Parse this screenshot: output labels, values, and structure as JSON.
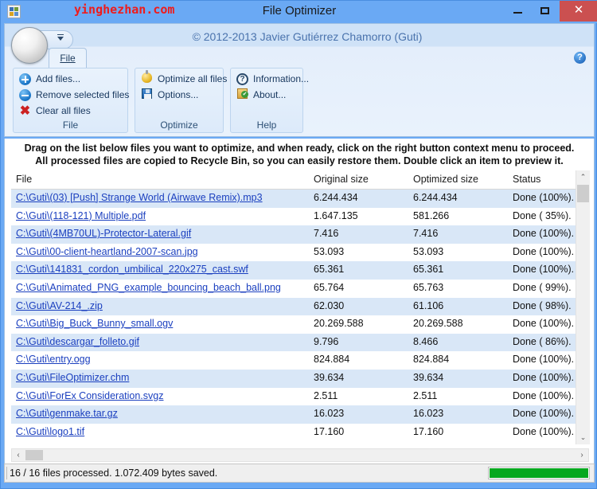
{
  "titlebar": {
    "app_icon": "app-grid-icon",
    "watermark": "yinghezhan.com",
    "title": "File Optimizer",
    "minimize_label": "",
    "maximize_label": "",
    "close_label": ""
  },
  "ribbon": {
    "copyright": "© 2012-2013 Javier Gutiérrez Chamorro (Guti)",
    "tab_label": "File",
    "help_glyph": "?",
    "groups": [
      {
        "label": "File",
        "items": [
          {
            "icon": "add-circle-icon",
            "label": "Add files..."
          },
          {
            "icon": "remove-circle-icon",
            "label": "Remove selected files"
          },
          {
            "icon": "red-x-icon",
            "label": "Clear all files"
          }
        ]
      },
      {
        "label": "Optimize",
        "items": [
          {
            "icon": "gold-bulb-icon",
            "label": "Optimize all files"
          },
          {
            "icon": "floppy-disk-icon",
            "label": "Options..."
          }
        ]
      },
      {
        "label": "Help",
        "items": [
          {
            "icon": "question-mark-icon",
            "label": "Information..."
          },
          {
            "icon": "about-badge-icon",
            "label": "About..."
          }
        ]
      }
    ]
  },
  "banner": {
    "line1": "Drag on the list below files you want to optimize, and when ready, click on the right button context menu to proceed. All",
    "line2": "processed files are copied to Recycle Bin, so you can easily restore them. Double click an item to preview it."
  },
  "list": {
    "columns": [
      "File",
      "Original size",
      "Optimized size",
      "Status"
    ],
    "rows": [
      {
        "file": "C:\\Guti\\(03) [Push] Strange World (Airwave Remix).mp3",
        "original": "6.244.434",
        "optimized": "6.244.434",
        "status": "Done (100%)."
      },
      {
        "file": "C:\\Guti\\(118-121) Multiple.pdf",
        "original": "1.647.135",
        "optimized": "581.266",
        "status": "Done ( 35%)."
      },
      {
        "file": "C:\\Guti\\(4MB70UL)-Protector-Lateral.gif",
        "original": "7.416",
        "optimized": "7.416",
        "status": "Done (100%)."
      },
      {
        "file": "C:\\Guti\\00-client-heartland-2007-scan.jpg",
        "original": "53.093",
        "optimized": "53.093",
        "status": "Done (100%)."
      },
      {
        "file": "C:\\Guti\\141831_cordon_umbilical_220x275_cast.swf",
        "original": "65.361",
        "optimized": "65.361",
        "status": "Done (100%)."
      },
      {
        "file": "C:\\Guti\\Animated_PNG_example_bouncing_beach_ball.png",
        "original": "65.764",
        "optimized": "65.763",
        "status": "Done ( 99%)."
      },
      {
        "file": "C:\\Guti\\AV-214_.zip",
        "original": "62.030",
        "optimized": "61.106",
        "status": "Done ( 98%)."
      },
      {
        "file": "C:\\Guti\\Big_Buck_Bunny_small.ogv",
        "original": "20.269.588",
        "optimized": "20.269.588",
        "status": "Done (100%)."
      },
      {
        "file": "C:\\Guti\\descargar_folleto.gif",
        "original": "9.796",
        "optimized": "8.466",
        "status": "Done ( 86%)."
      },
      {
        "file": "C:\\Guti\\entry.ogg",
        "original": "824.884",
        "optimized": "824.884",
        "status": "Done (100%)."
      },
      {
        "file": "C:\\Guti\\FileOptimizer.chm",
        "original": "39.634",
        "optimized": "39.634",
        "status": "Done (100%)."
      },
      {
        "file": "C:\\Guti\\ForEx Consideration.svgz",
        "original": "2.511",
        "optimized": "2.511",
        "status": "Done (100%)."
      },
      {
        "file": "C:\\Guti\\genmake.tar.gz",
        "original": "16.023",
        "optimized": "16.023",
        "status": "Done (100%)."
      },
      {
        "file": "C:\\Guti\\logo1.tif",
        "original": "17.160",
        "optimized": "17.160",
        "status": "Done (100%)."
      }
    ]
  },
  "scrollbars": {
    "up_glyph": "⌃",
    "down_glyph": "⌄",
    "left_glyph": "‹",
    "right_glyph": "›"
  },
  "statusbar": {
    "text": "16 / 16 files processed. 1.072.409 bytes saved.",
    "progress_percent": 100
  },
  "colors": {
    "window_frame": "#6aa9f4",
    "close_button": "#cb5050",
    "link": "#1a3fbf",
    "row_alt": "#d9e7f7",
    "progress": "#06a81f",
    "watermark": "#ef1b1b",
    "copyright": "#4a73ad"
  }
}
